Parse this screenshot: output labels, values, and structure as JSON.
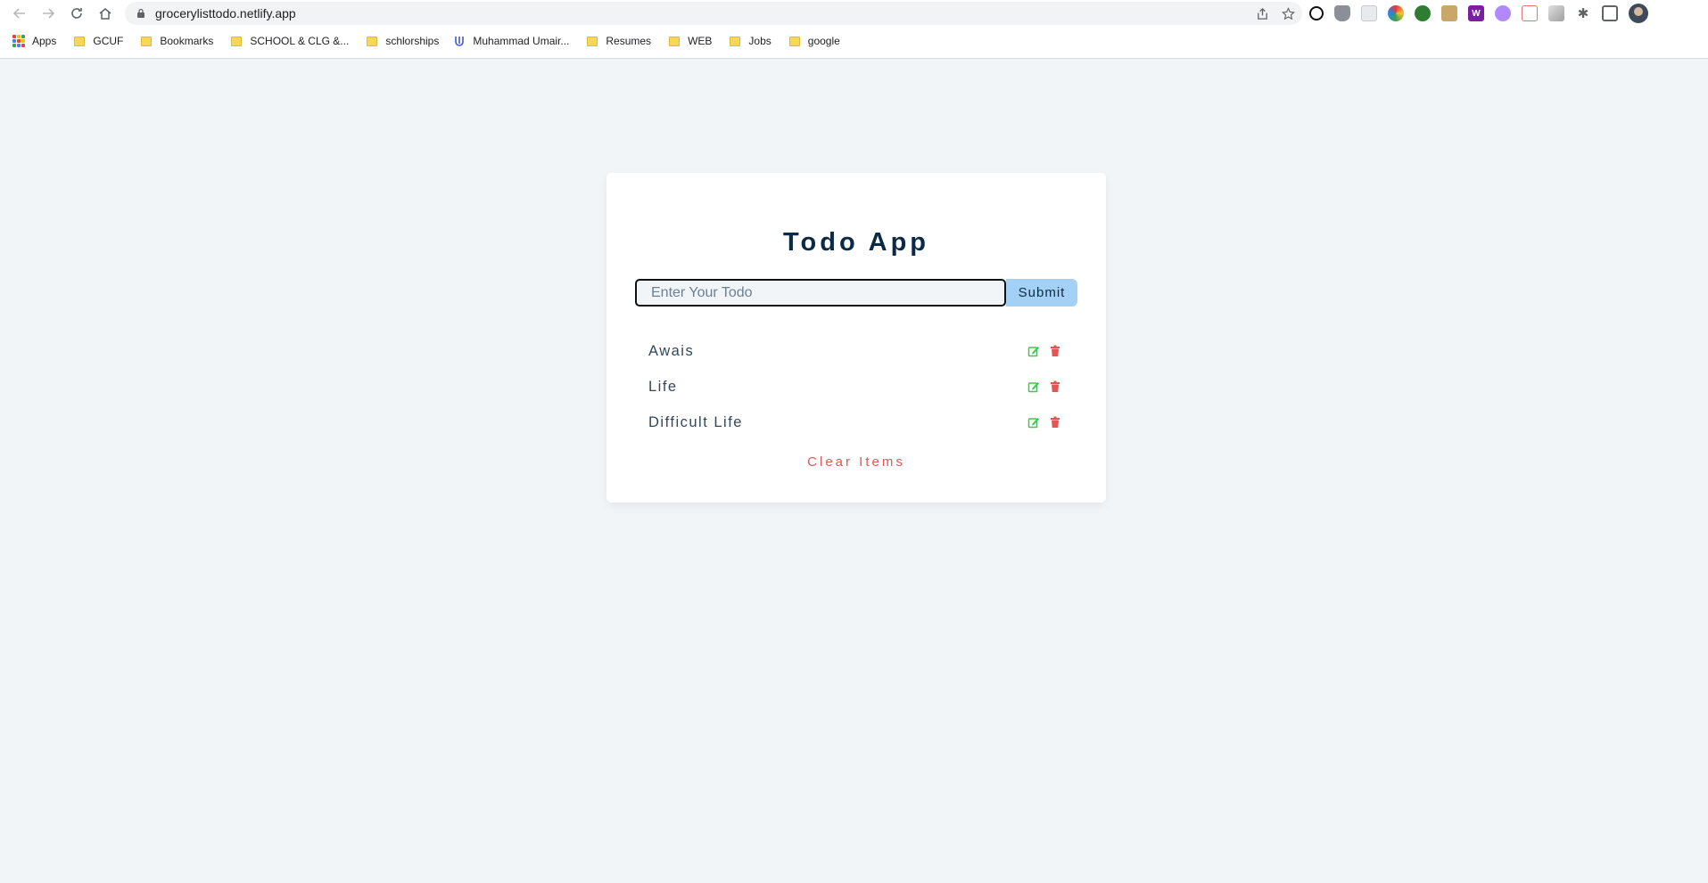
{
  "browser": {
    "url": "grocerylisttodo.netlify.app",
    "bookmarks": [
      {
        "label": "Apps",
        "type": "apps"
      },
      {
        "label": "GCUF",
        "type": "folder"
      },
      {
        "label": "Bookmarks",
        "type": "folder"
      },
      {
        "label": "SCHOOL & CLG &...",
        "type": "folder"
      },
      {
        "label": "schlorships",
        "type": "folder"
      },
      {
        "label": "Muhammad Umair...",
        "type": "link"
      },
      {
        "label": "Resumes",
        "type": "folder"
      },
      {
        "label": "WEB",
        "type": "folder"
      },
      {
        "label": "Jobs",
        "type": "folder"
      },
      {
        "label": "google",
        "type": "folder"
      }
    ]
  },
  "app": {
    "title": "Todo App",
    "input_placeholder": "Enter Your Todo",
    "input_value": "",
    "submit_label": "Submit",
    "items": [
      {
        "text": "Awais"
      },
      {
        "text": "Life"
      },
      {
        "text": "Difficult Life"
      }
    ],
    "clear_label": "Clear Items"
  },
  "colors": {
    "page_bg": "#f1f5f8",
    "title": "#0b2a46",
    "submit_bg": "#a3d1f5",
    "edit": "#46c35a",
    "delete": "#e05656"
  }
}
